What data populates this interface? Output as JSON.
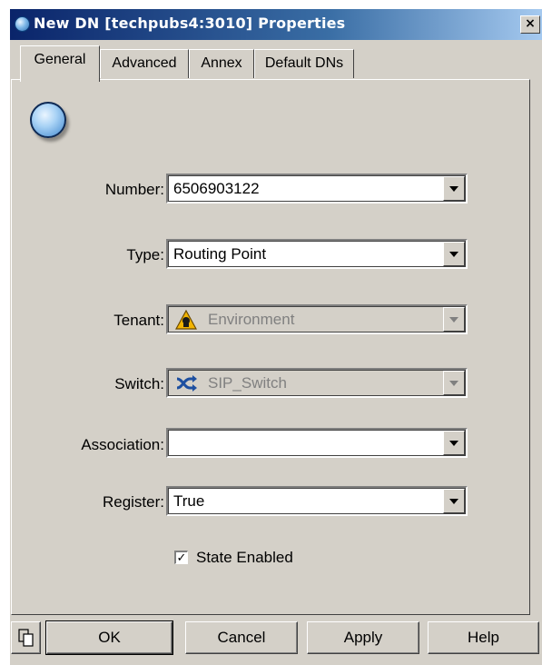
{
  "window": {
    "title": "New DN [techpubs4:3010] Properties",
    "close_label": "×"
  },
  "tabs": [
    {
      "label": "General",
      "active": true
    },
    {
      "label": "Advanced",
      "active": false
    },
    {
      "label": "Annex",
      "active": false
    },
    {
      "label": "Default DNs",
      "active": false
    }
  ],
  "form": {
    "number": {
      "label": "Number:",
      "value": "6506903122"
    },
    "type": {
      "label": "Type:",
      "value": "Routing Point"
    },
    "tenant": {
      "label": "Tenant:",
      "value": "Environment",
      "icon": "warning-tenant-icon",
      "disabled": true
    },
    "switch": {
      "label": "Switch:",
      "value": "SIP_Switch",
      "icon": "switch-icon",
      "disabled": true
    },
    "association": {
      "label": "Association:",
      "value": ""
    },
    "register": {
      "label": "Register:",
      "value": "True"
    },
    "state_enabled": {
      "label": "State Enabled",
      "checked": true,
      "mark": "✓"
    }
  },
  "buttons": {
    "copy_icon": "copy-icon",
    "ok": "OK",
    "cancel": "Cancel",
    "apply": "Apply",
    "help": "Help"
  },
  "colors": {
    "face": "#d4d0c8",
    "titlebar_start": "#0a246a",
    "titlebar_end": "#a6caf0"
  }
}
